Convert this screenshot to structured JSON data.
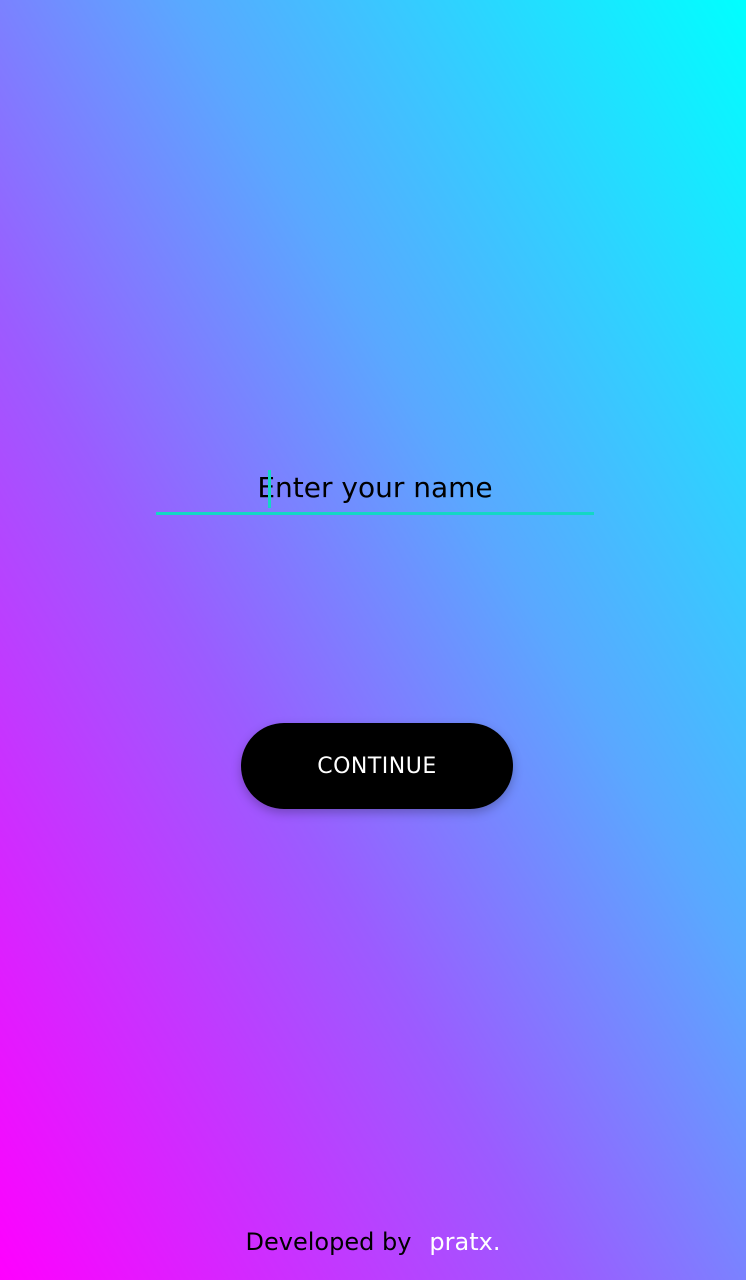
{
  "form": {
    "name_placeholder": "Enter your name",
    "name_value": "",
    "continue_label": "CONTINUE"
  },
  "footer": {
    "developed_by": "Developed by",
    "developer": "pratx."
  },
  "colors": {
    "gradient_top_right": "#00ffff",
    "gradient_bottom_left": "#ff00ff",
    "accent": "#14d7c4",
    "button_bg": "#000000",
    "button_text": "#ffffff"
  }
}
